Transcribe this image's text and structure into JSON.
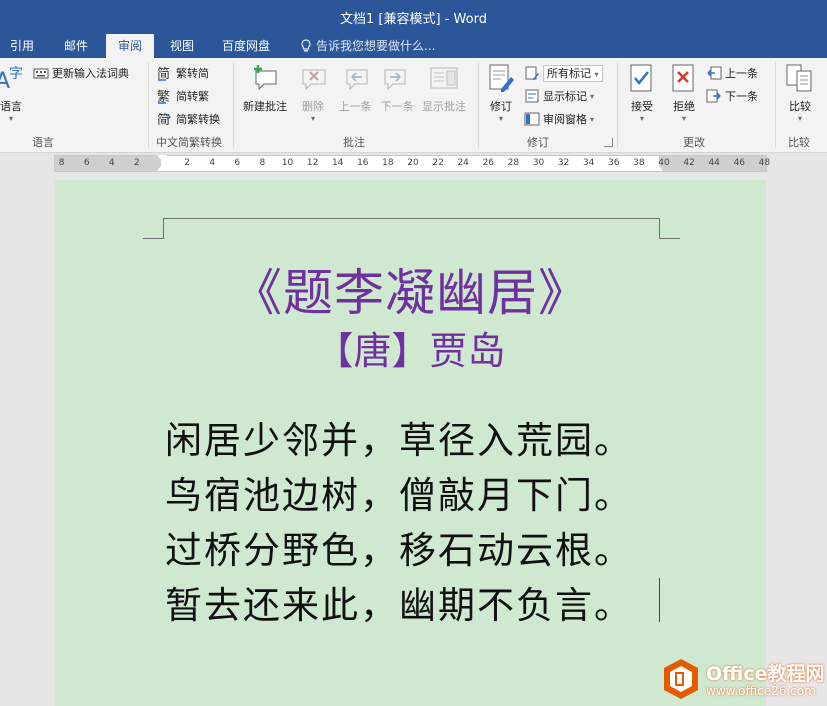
{
  "window": {
    "title": "文档1 [兼容模式] - Word"
  },
  "tabs": [
    {
      "label": "引用"
    },
    {
      "label": "邮件"
    },
    {
      "label": "审阅",
      "active": true
    },
    {
      "label": "视图"
    },
    {
      "label": "百度网盘"
    }
  ],
  "tellme": {
    "text": "告诉我您想要做什么..."
  },
  "ribbon": {
    "language": {
      "item_update_ime": "更新输入法词典",
      "item_language": "语言",
      "label": "语言"
    },
    "chinese": {
      "to_simplified": "繁转简",
      "to_traditional": "简转繁",
      "convert": "简繁转换",
      "label": "中文简繁转换"
    },
    "comments": {
      "new": "新建批注",
      "delete": "删除",
      "previous": "上一条",
      "next": "下一条",
      "show": "显示批注",
      "label": "批注"
    },
    "tracking": {
      "track_changes": "修订",
      "markup_combo": "所有标记",
      "show_markup": "显示标记",
      "reviewing_pane": "审阅窗格",
      "label": "修订"
    },
    "changes": {
      "accept": "接受",
      "reject": "拒绝",
      "previous": "上一条",
      "next": "下一条",
      "label": "更改"
    },
    "compare": {
      "compare": "比较",
      "label": "比较"
    }
  },
  "ruler": {
    "left_ticks": [
      "8",
      "6",
      "4",
      "2"
    ],
    "right_ticks": [
      "2",
      "4",
      "6",
      "8",
      "10",
      "12",
      "14",
      "16",
      "18",
      "20",
      "22",
      "24",
      "26",
      "28",
      "30",
      "32",
      "34",
      "36",
      "38",
      "40",
      "42",
      "44",
      "46",
      "48"
    ]
  },
  "document": {
    "title": "《题李凝幽居》",
    "author": "【唐】贾岛",
    "lines": [
      "闲居少邻并，草径入荒园。",
      "鸟宿池边树，僧敲月下门。",
      "过桥分野色，移石动云根。",
      "暂去还来此，幽期不负言。"
    ]
  },
  "watermark": {
    "brand": "Office教程网",
    "url": "www.office26.com"
  },
  "colors": {
    "title_bar": "#2b579a",
    "page_background": "#cfe8d0",
    "poem_heading": "#7030a0",
    "logo_orange": "#e55a00"
  }
}
